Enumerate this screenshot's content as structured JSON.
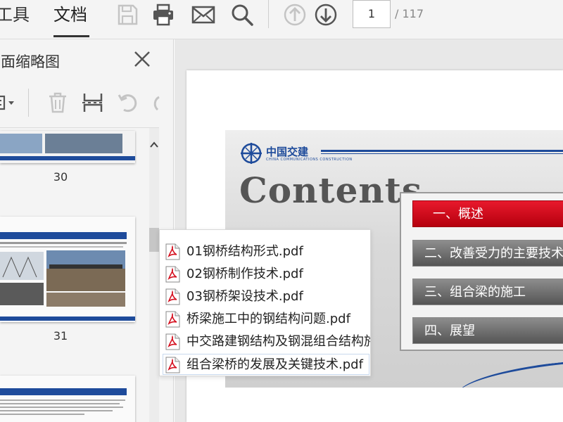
{
  "toolbar": {
    "menu_tools": "工具",
    "menu_document": "文档",
    "icons": [
      "save-icon",
      "print-icon",
      "mail-icon",
      "search-icon",
      "arrow-up-icon",
      "arrow-down-icon"
    ],
    "page_current": "1",
    "page_total": "/ 117"
  },
  "sidepanel": {
    "title": "页面缩略图",
    "tool_icons": [
      "page-options-icon",
      "trash-icon",
      "crop-icon",
      "undo-icon"
    ],
    "thumbnails": [
      {
        "label": "30"
      },
      {
        "label": "31"
      }
    ]
  },
  "attachments": {
    "items": [
      "01钢桥结构形式.pdf",
      "02钢桥制作技术.pdf",
      "03钢桥架设技术.pdf",
      "桥梁施工中的钢结构问题.pdf",
      "中交路建钢结构及钢混组合结构施",
      "组合梁桥的发展及关键技术.pdf"
    ],
    "selected_index": 5
  },
  "slide": {
    "logo_text": "中国交建",
    "logo_sub": "CHINA COMMUNICATIONS CONSTRUCTION",
    "title": "Contents",
    "items": [
      "一、概述",
      "二、改善受力的主要技术",
      "三、组合梁的施工",
      "四、展望"
    ],
    "active_index": 0
  },
  "colors": {
    "accent_red": "#d5101f",
    "brand_blue": "#1e4b9b",
    "toolbar_bg": "#f4f4f4"
  }
}
